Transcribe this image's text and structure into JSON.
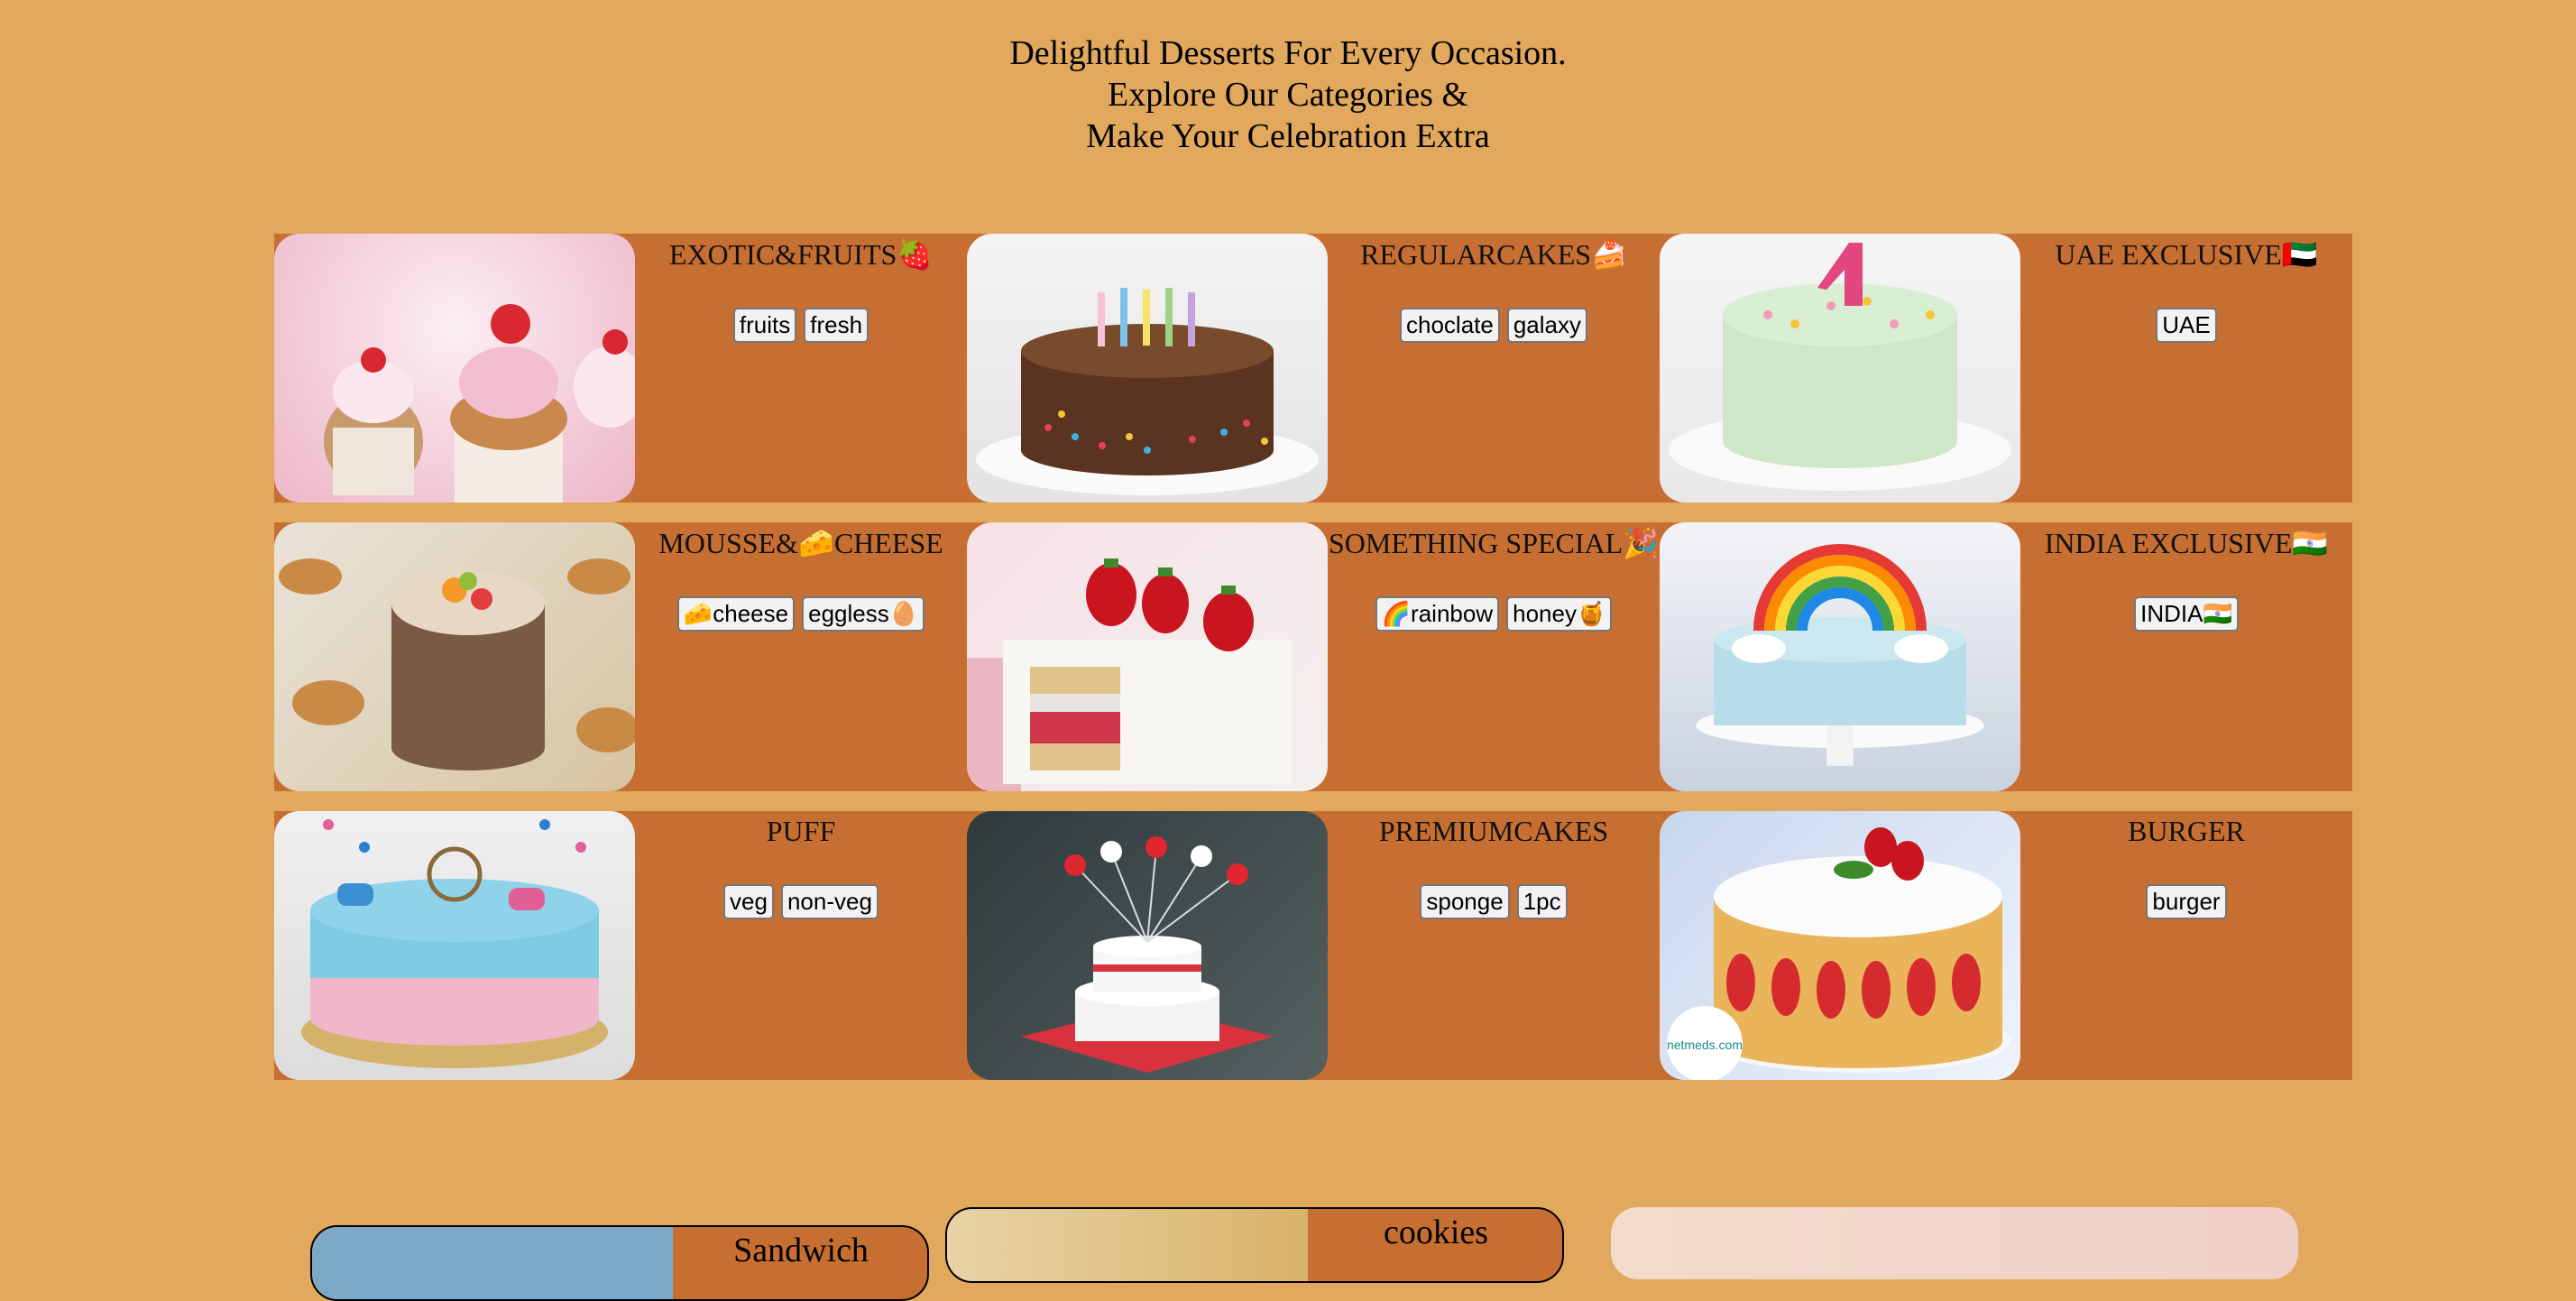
{
  "hero": {
    "line1": "Delightful Desserts For Every Occasion.",
    "line2": "Explore Our Categories &",
    "line3": "Make Your Celebration Extra"
  },
  "categories": [
    {
      "title": "EXOTIC&FRUITS🍓",
      "tags": [
        "fruits",
        "fresh"
      ]
    },
    {
      "title": "REGULARCAKES🍰",
      "tags": [
        "choclate",
        "galaxy"
      ]
    },
    {
      "title": "UAE EXCLUSIVE🇦🇪",
      "tags": [
        "UAE"
      ]
    },
    {
      "title": "MOUSSE&🧀CHEESE",
      "tags": [
        "🧀cheese",
        "eggless🥚"
      ]
    },
    {
      "title": "SOMETHING SPECIAL🎉",
      "tags": [
        "🌈rainbow",
        "honey🍯"
      ]
    },
    {
      "title": "INDIA EXCLUSIVE🇮🇳",
      "tags": [
        "INDIA🇮🇳"
      ]
    },
    {
      "title": "PUFF",
      "tags": [
        "veg",
        "non-veg"
      ]
    },
    {
      "title": "PREMIUMCAKES",
      "tags": [
        "sponge",
        "1pc"
      ]
    },
    {
      "title": "BURGER",
      "tags": [
        "burger"
      ]
    }
  ],
  "image_logo_text": "netmeds.com",
  "bottom": {
    "card1_title": "Sandwich",
    "card2_title": "cookies"
  },
  "colors": {
    "page_bg": "#e2a95e",
    "row_bg": "#c76f32"
  }
}
